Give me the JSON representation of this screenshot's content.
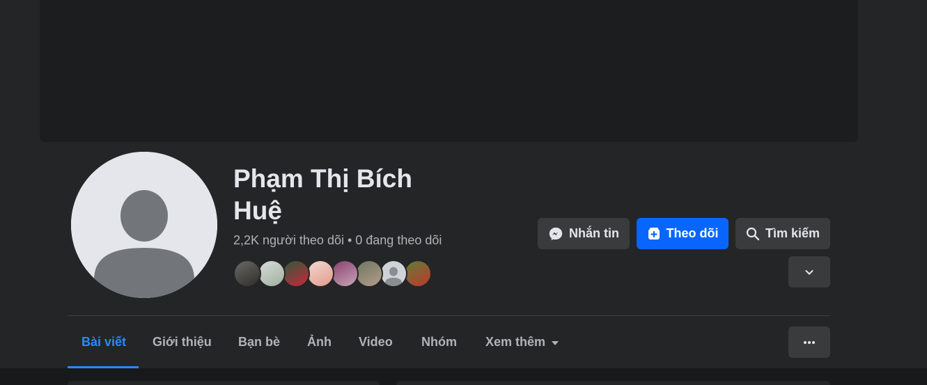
{
  "profile": {
    "name": "Phạm Thị Bích Huệ",
    "stats": "2,2K người theo dõi • 0 đang theo dõi",
    "friend_avatars": [
      {
        "icon": "friend-photo-1",
        "colors": [
          "#6b6a64",
          "#2f2c2a"
        ]
      },
      {
        "icon": "friend-photo-2",
        "colors": [
          "#d9dbd8",
          "#9fb0a0"
        ]
      },
      {
        "icon": "friend-photo-3",
        "colors": [
          "#2d5b3a",
          "#c9273d"
        ]
      },
      {
        "icon": "friend-photo-4",
        "colors": [
          "#f1d8d0",
          "#e29b8c"
        ]
      },
      {
        "icon": "friend-photo-5",
        "colors": [
          "#8a3f6f",
          "#c7a6b6"
        ]
      },
      {
        "icon": "friend-photo-6",
        "colors": [
          "#6f7660",
          "#b39d8a"
        ]
      },
      {
        "icon": "default-avatar",
        "colors": [
          "#d0d3d8",
          "#8a8d91"
        ]
      },
      {
        "icon": "friend-photo-8",
        "colors": [
          "#5f7c39",
          "#c0392b"
        ]
      }
    ]
  },
  "actions": {
    "message": {
      "label": "Nhắn tin",
      "icon": "messenger-icon"
    },
    "follow": {
      "label": "Theo dõi",
      "icon": "follow-icon",
      "color": "#0866ff"
    },
    "search": {
      "label": "Tìm kiếm",
      "icon": "search-icon"
    },
    "more": {
      "icon": "chevron-down-icon"
    }
  },
  "tabs": [
    {
      "label": "Bài viết",
      "active": true
    },
    {
      "label": "Giới thiệu"
    },
    {
      "label": "Bạn bè"
    },
    {
      "label": "Ảnh"
    },
    {
      "label": "Video"
    },
    {
      "label": "Nhóm"
    },
    {
      "label": "Xem thêm",
      "dropdown": true
    }
  ],
  "tab_more_icon": "ellipsis-icon",
  "colors": {
    "background": "#242526",
    "cover": "#1c1d1f",
    "accent": "#2d88ff",
    "text_secondary": "#b0b3b8"
  }
}
